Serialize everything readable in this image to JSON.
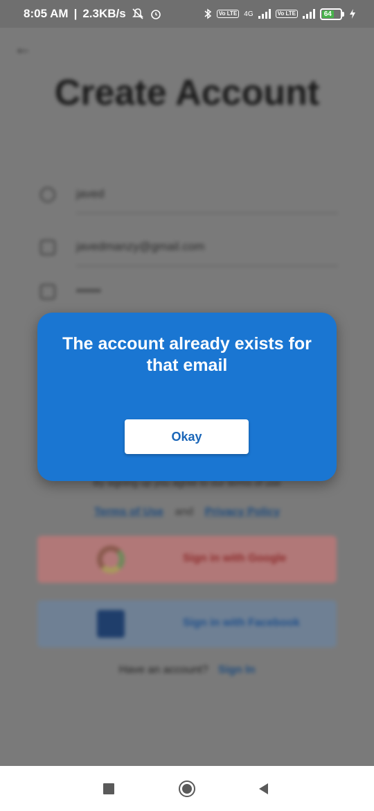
{
  "status_bar": {
    "time": "8:05 AM",
    "net_speed": "2.3KB/s",
    "separator": "|",
    "network_4g": "4G",
    "volte_1": "Vo LTE",
    "volte_2": "Vo LTE",
    "battery": "64",
    "icons": [
      "mute-icon",
      "alarm-icon",
      "bluetooth-icon",
      "signal-icon",
      "battery-icon",
      "charging-icon"
    ]
  },
  "background": {
    "title": "Create Account",
    "fields": [
      {
        "icon": "person-icon",
        "value": "javed"
      },
      {
        "icon": "email-icon",
        "value": "javedmanzy@gmail.com"
      },
      {
        "icon": "lock-icon",
        "value": "••••••"
      }
    ],
    "terms_text": "By signing up you agree to our terms of use",
    "terms_link": "Terms of Use",
    "and": "and",
    "privacy_link": "Privacy Policy",
    "google_label": "Sign in with Google",
    "facebook_label": "Sign in with Facebook",
    "have_account": "Have an account?",
    "sign_in": "Sign In"
  },
  "dialog": {
    "message": "The account already exists for that email",
    "ok_label": "Okay",
    "color": "#1a76d2"
  },
  "nav": {
    "icons": [
      "recent-apps-icon",
      "home-icon",
      "back-icon"
    ]
  }
}
